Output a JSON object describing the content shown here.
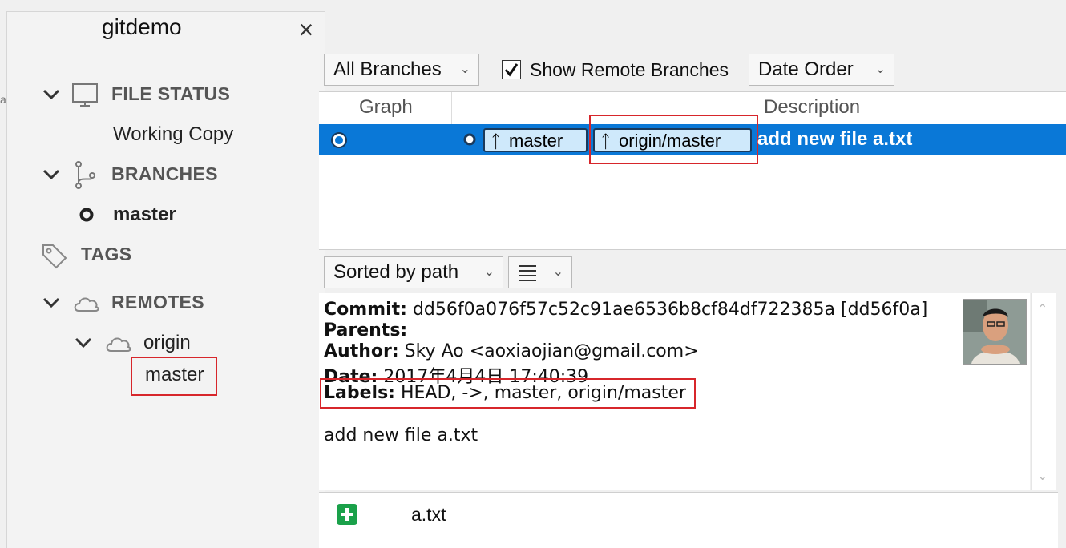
{
  "window": {
    "tab_title": "gitdemo",
    "close_glyph": "×"
  },
  "sidebar": {
    "file_status": {
      "label": "FILE STATUS",
      "items": [
        "Working Copy"
      ]
    },
    "branches": {
      "label": "BRANCHES",
      "items": [
        "master"
      ]
    },
    "tags": {
      "label": "TAGS"
    },
    "remotes": {
      "label": "REMOTES",
      "origin": {
        "label": "origin",
        "items": [
          "master"
        ]
      }
    }
  },
  "toolbar": {
    "branch_filter": "All Branches",
    "show_remote_label": "Show Remote Branches",
    "show_remote_checked": true,
    "order": "Date Order"
  },
  "commit_list": {
    "columns": [
      "Graph",
      "Description"
    ],
    "rows": [
      {
        "labels": [
          "master",
          "origin/master"
        ],
        "message": "add new file a.txt",
        "selected": true
      }
    ]
  },
  "details_toolbar": {
    "sort": "Sorted by path",
    "view_icon": "list-icon"
  },
  "commit_detail": {
    "commit_label": "Commit:",
    "commit_value": "dd56f0a076f57c52c91ae6536b8cf84df722385a [dd56f0a]",
    "parents_label": "Parents:",
    "parents_value": "",
    "author_label": "Author:",
    "author_value": "Sky Ao <aoxiaojian@gmail.com>",
    "date_label": "Date:",
    "date_value": "2017年4月4日 17:40:39",
    "labels_label": "Labels:",
    "labels_value": "HEAD, ->, master, origin/master",
    "message": "add new file a.txt"
  },
  "files": [
    {
      "status": "added",
      "name": "a.txt"
    }
  ],
  "colors": {
    "selection": "#0a78d7",
    "highlight_box": "#d7262b",
    "badge_bg": "#cfe9fb",
    "added": "#1aa14a"
  }
}
